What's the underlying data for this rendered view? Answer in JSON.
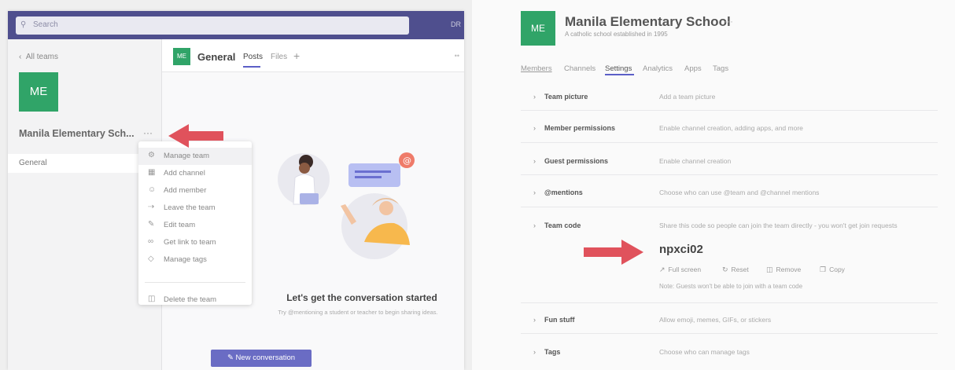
{
  "left": {
    "search_placeholder": "Search",
    "topbar_right": "DR",
    "back_link": "All teams",
    "team_initials": "ME",
    "team_name": "Manila Elementary Sch...",
    "team_more": "···",
    "channel": "General",
    "context_menu": [
      {
        "label": "Manage team",
        "icon": "gear-icon"
      },
      {
        "label": "Add channel",
        "icon": "add-channel-icon"
      },
      {
        "label": "Add member",
        "icon": "add-member-icon"
      },
      {
        "label": "Leave the team",
        "icon": "leave-icon"
      },
      {
        "label": "Edit team",
        "icon": "pencil-icon"
      },
      {
        "label": "Get link to team",
        "icon": "link-icon"
      },
      {
        "label": "Manage tags",
        "icon": "tag-icon"
      },
      {
        "label": "Delete the team",
        "icon": "trash-icon"
      }
    ],
    "channel_header": {
      "initials": "ME",
      "title": "General",
      "tab_posts": "Posts",
      "tab_files": "Files",
      "tab_add": "+"
    },
    "empty_state": {
      "title": "Let's get the conversation started",
      "subtitle": "Try @mentioning a student or teacher to begin sharing ideas."
    },
    "new_conversation": "New conversation"
  },
  "right": {
    "team_initials": "ME",
    "team_name": "Manila Elementary School",
    "team_more": "···",
    "team_desc": "A catholic school established in 1995",
    "tabs": [
      "Members",
      "Channels",
      "Settings",
      "Analytics",
      "Apps",
      "Tags"
    ],
    "active_tab": "Settings",
    "settings": [
      {
        "label": "Team picture",
        "desc": "Add a team picture"
      },
      {
        "label": "Member permissions",
        "desc": "Enable channel creation, adding apps, and more"
      },
      {
        "label": "Guest permissions",
        "desc": "Enable channel creation"
      },
      {
        "label": "@mentions",
        "desc": "Choose who can use @team and @channel mentions"
      },
      {
        "label": "Team code",
        "desc": "Share this code so people can join the team directly - you won't get join requests"
      },
      {
        "label": "Fun stuff",
        "desc": "Allow emoji, memes, GIFs, or stickers"
      },
      {
        "label": "Tags",
        "desc": "Choose who can manage tags"
      }
    ],
    "team_code": "npxci02",
    "code_actions": [
      "Full screen",
      "Reset",
      "Remove",
      "Copy"
    ],
    "code_note": "Note: Guests won't be able to join with a team code"
  },
  "colors": {
    "topbar": "#4f4f8e",
    "accent": "#5b5fc7",
    "team_green": "#30a468",
    "arrow_red": "#e0525c",
    "button": "#6a6cc4"
  }
}
